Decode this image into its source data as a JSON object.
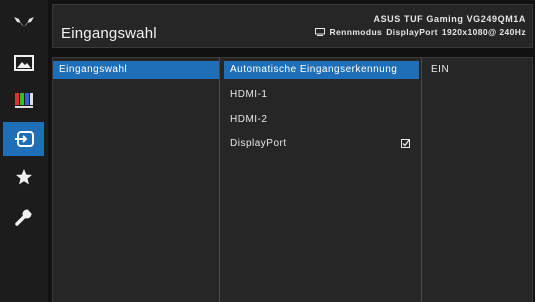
{
  "header": {
    "title": "Eingangswahl",
    "model": "ASUS TUF Gaming  VG249QM1A",
    "status_mode": "Rennmodus",
    "status_input": "DisplayPort",
    "status_resolution": "1920x1080@ 240Hz"
  },
  "sidebar": {
    "items": [
      {
        "icon": "tuf-logo-icon"
      },
      {
        "icon": "image-icon"
      },
      {
        "icon": "color-bars-icon"
      },
      {
        "icon": "input-select-icon",
        "active": true
      },
      {
        "icon": "star-icon"
      },
      {
        "icon": "wrench-icon"
      }
    ]
  },
  "menu": {
    "level1": [
      "Eingangswahl"
    ],
    "level2": [
      "Automatische Eingangserkennung",
      "HDMI-1",
      "HDMI-2",
      "DisplayPort"
    ],
    "level3": [
      "EIN"
    ],
    "checked_item": "DisplayPort"
  },
  "colors": {
    "accent": "#1e6fb8",
    "background": "#262626"
  }
}
